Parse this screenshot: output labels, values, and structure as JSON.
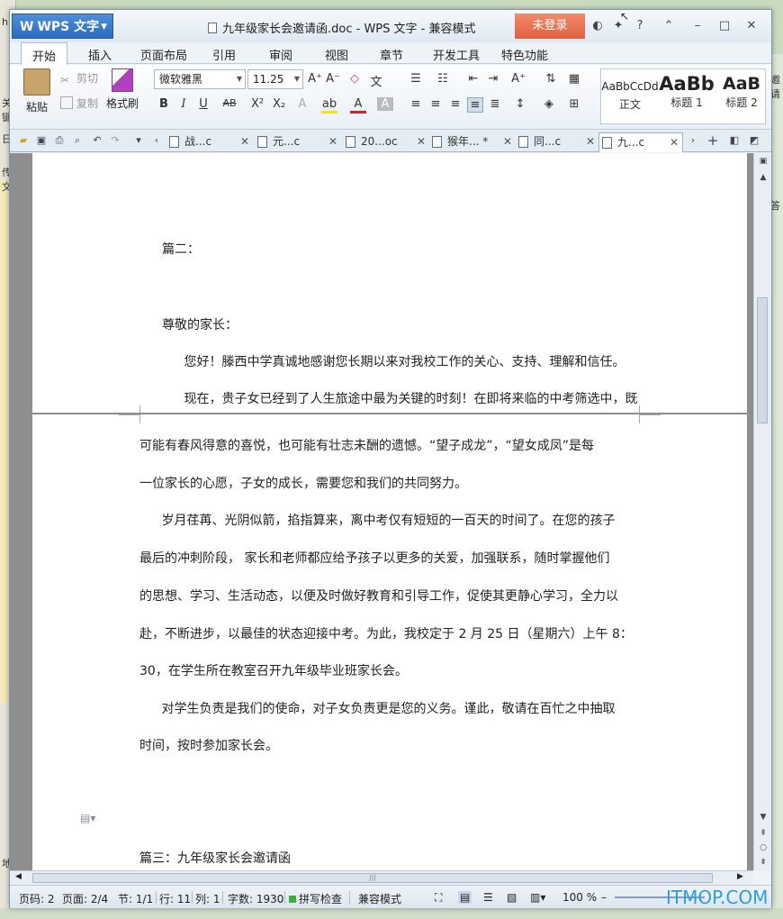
{
  "background": {
    "left_labels": [
      "h",
      "关键",
      "日",
      "传文",
      "地"
    ],
    "right_labels": [
      "邀请",
      "答"
    ]
  },
  "titlebar": {
    "app_menu": "WPS 文字",
    "title": "九年级家长会邀请函.doc - WPS 文字 - 兼容模式",
    "login": "未登录",
    "help": "?"
  },
  "menu": {
    "tabs": [
      "开始",
      "插入",
      "页面布局",
      "引用",
      "审阅",
      "视图",
      "章节",
      "开发工具",
      "特色功能"
    ]
  },
  "ribbon": {
    "paste": "粘贴",
    "cut": "剪切",
    "copy": "复制",
    "format_painter": "格式刷",
    "font_name": "微软雅黑",
    "font_size": "11.25",
    "bold": "B",
    "italic": "I",
    "underline": "U",
    "strike": "AB",
    "superscript": "X²",
    "subscript": "X₂",
    "styles": [
      {
        "sample": "AaBbCcDd",
        "name": "正文"
      },
      {
        "sample": "AaBb",
        "name": "标题 1"
      },
      {
        "sample": "AaB",
        "name": "标题 2"
      }
    ]
  },
  "doc_tabs": [
    {
      "label": "战...c"
    },
    {
      "label": "元...c"
    },
    {
      "label": "20...oc"
    },
    {
      "label": "猴年... *"
    },
    {
      "label": "同...c"
    },
    {
      "label": "九...c"
    }
  ],
  "document": {
    "page1_lines": [
      "篇二：",
      "尊敬的家长：",
      "    您好！滕西中学真诚地感谢您长期以来对我校工作的关心、支持、理解和信任。",
      "    现在，贵子女已经到了人生旅途中最为关键的时刻！在即将来临的中考筛选中，既"
    ],
    "page2_lines": [
      "可能有春风得意的喜悦，也可能有壮志未酬的遗憾。“望子成龙”，“望女成凤”是每",
      "一位家长的心愿，子女的成长，需要您和我们的共同努力。",
      "    岁月荏苒、光阴似箭，掐指算来，离中考仅有短短的一百天的时间了。在您的孩子",
      "最后的冲刺阶段， 家长和老师都应给予孩子以更多的关爱，加强联系，随时掌握他们",
      "的思想、学习、生活动态，以便及时做好教育和引导工作，促使其更静心学习，全力以",
      "赴，不断进步，以最佳的状态迎接中考。为此，我校定于 2 月 25 日（星期六）上午 8：",
      "30，在学生所在教室召开九年级毕业班家长会。",
      "    对学生负责是我们的使命，对子女负责更是您的义务。谨此，敬请在百忙之中抽取",
      "时间，按时参加家长会。",
      "篇三：九年级家长会邀请函"
    ]
  },
  "status": {
    "page_code": "页码: 2",
    "pages": "页面: 2/4",
    "section": "节: 1/1",
    "row": "行: 11",
    "col": "列: 1",
    "words": "字数: 1930",
    "spell": "拼写检查",
    "mode": "兼容模式",
    "zoom": "100 %"
  },
  "watermark": "ITMOP.COM"
}
